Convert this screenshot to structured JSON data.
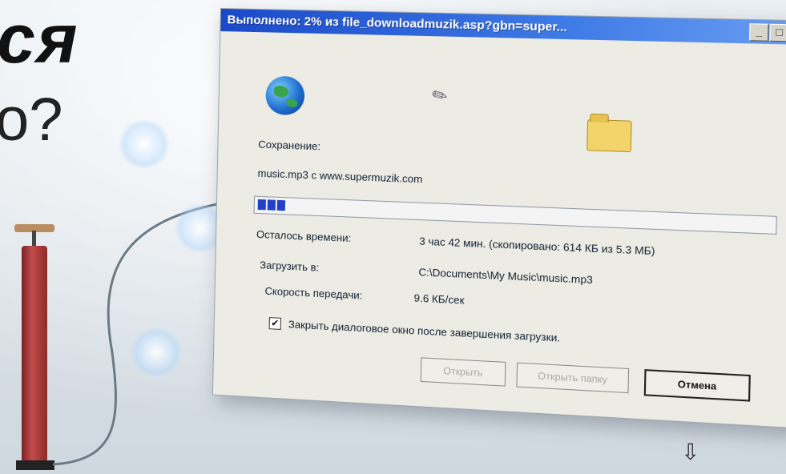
{
  "headline": {
    "line1": "ся",
    "line2": "о?"
  },
  "dialog": {
    "title": "Выполнено: 2% из file_downloadmuzik.asp?gbn=super...",
    "saving_label": "Сохранение:",
    "file_source": "music.mp3 с www.supermuzik.com",
    "progress_percent": 2,
    "time_left_label": "Осталось времени:",
    "time_left_value": "3 час 42 мин. (скопировано: 614 КБ из 5.3 МБ)",
    "download_to_label": "Загрузить в:",
    "download_to_value": "C:\\Documents\\My Music\\music.mp3",
    "speed_label": "Скорость передачи:",
    "speed_value": "9.6 КБ/сек",
    "close_checkbox_label": "Закрыть диалоговое окно после завершения загрузки.",
    "close_checkbox_checked": true,
    "buttons": {
      "open": "Открыть",
      "open_folder": "Открыть папку",
      "cancel": "Отмена"
    },
    "window_controls": {
      "minimize": "_",
      "maximize": "□",
      "close": "✕"
    }
  },
  "icons": {
    "globe": "globe-icon",
    "paper": "paper-flying-icon",
    "folder": "folder-icon",
    "down_arrow": "download-arrow-icon"
  }
}
